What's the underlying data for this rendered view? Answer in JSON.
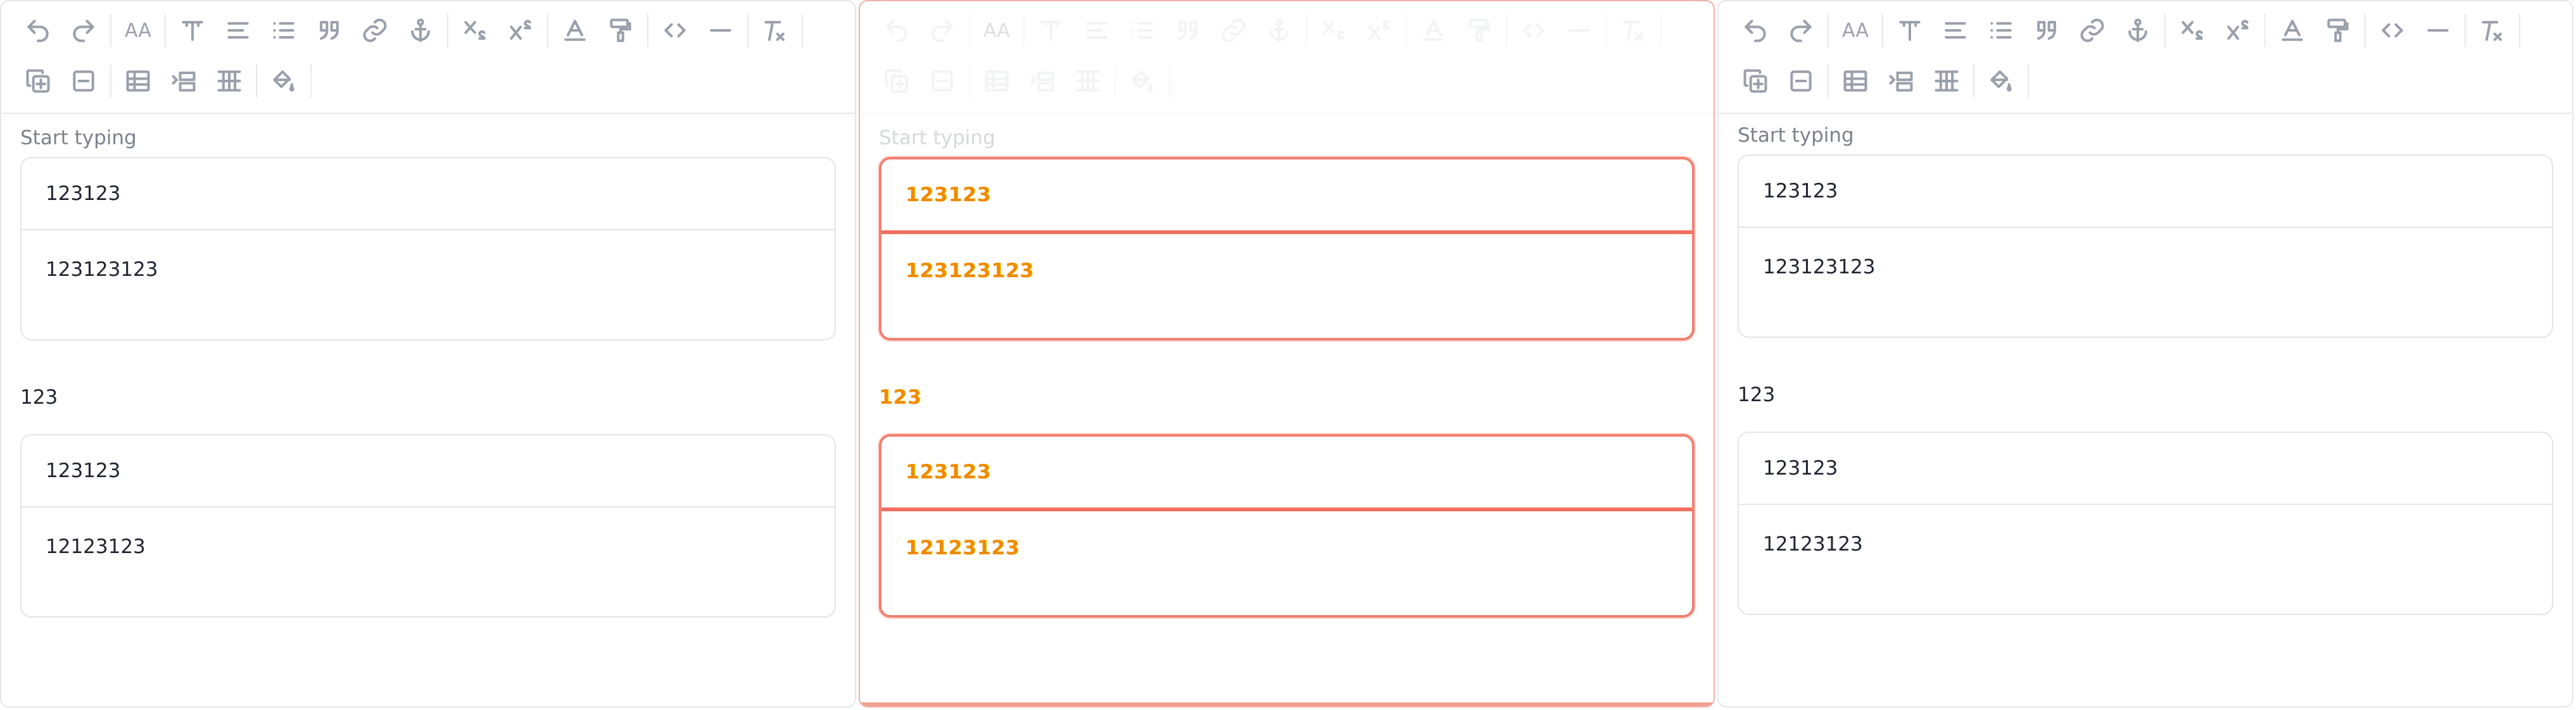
{
  "editors": [
    {
      "placeholder": "Start typing",
      "blocks": [
        {
          "rows": [
            "123123",
            "123123123"
          ]
        },
        {
          "rows": [
            "123123",
            "12123123"
          ]
        }
      ],
      "heading": "123"
    },
    {
      "placeholder": "Start typing",
      "blocks": [
        {
          "rows": [
            "123123",
            "123123123"
          ]
        },
        {
          "rows": [
            "123123",
            "12123123"
          ]
        }
      ],
      "heading": "123"
    },
    {
      "placeholder": "Start typing",
      "blocks": [
        {
          "rows": [
            "123123",
            "123123123"
          ]
        },
        {
          "rows": [
            "123123",
            "12123123"
          ]
        }
      ],
      "heading": "123"
    }
  ],
  "toolbar": {
    "font_size_label": "AA",
    "row1_icons": [
      "undo-icon",
      "redo-icon",
      "font-size-icon",
      "text-style-icon",
      "align-icon",
      "list-icon",
      "quote-icon",
      "link-icon",
      "anchor-icon",
      "subscript-icon",
      "superscript-icon",
      "text-color-icon",
      "paint-roller-icon",
      "code-icon",
      "horizontal-rule-icon",
      "clear-format-icon"
    ],
    "row2_icons": [
      "add-row-icon",
      "remove-row-icon",
      "table-icon",
      "indent-icon",
      "grid-icon",
      "fill-color-icon"
    ]
  }
}
